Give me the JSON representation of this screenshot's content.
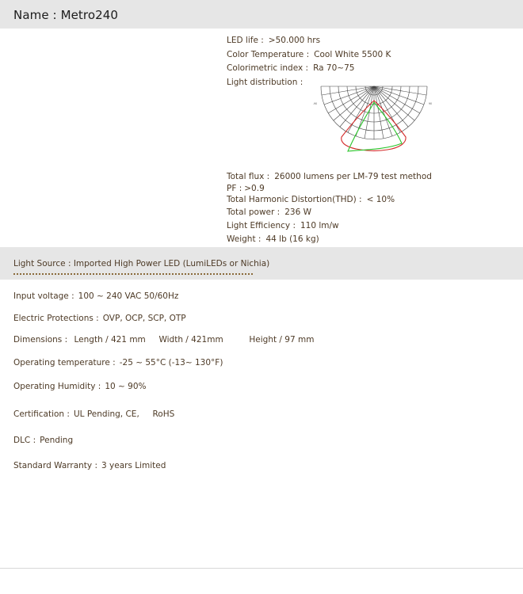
{
  "header": {
    "label": "Name :",
    "value": "Metro240"
  },
  "specs": {
    "led_life": {
      "label": "LED life :",
      "value": ">50.000 hrs"
    },
    "color_temperature": {
      "label": "Color Temperature :",
      "value": "Cool White 5500 K"
    },
    "colorimetric_index": {
      "label": "Colorimetric index :",
      "value": "Ra 70~75"
    },
    "light_distribution": {
      "label": "Light distribution :"
    },
    "total_flux": {
      "label": "Total flux :",
      "value": "26000 lumens per LM-79 test method"
    },
    "pf": {
      "label": "PF :",
      "value": ">0.9"
    },
    "thd": {
      "label": "Total Harmonic Distortion(THD) :",
      "value": "< 10%"
    },
    "total_power": {
      "label": "Total power :",
      "value": "236 W"
    },
    "light_efficiency": {
      "label": "Light Efficiency :",
      "value": "110 lm/w"
    },
    "weight": {
      "label": "Weight :",
      "value": "44 lb (16 kg)"
    }
  },
  "light_source": {
    "text": "Light Source : Imported High Power LED (LumiLEDs or Nichia)"
  },
  "details": {
    "input_voltage": {
      "label": "Input voltage :",
      "value": "100 ~ 240 VAC 50/60Hz"
    },
    "electric_protections": {
      "label": "Electric Protections :",
      "value": "OVP, OCP, SCP, OTP"
    },
    "dimensions": {
      "label": "Dimensions :",
      "length": "Length / 421 mm",
      "width": "Width / 421mm",
      "height": "Height / 97 mm"
    },
    "operating_temperature": {
      "label": "Operating temperature :",
      "value": "-25 ~ 55°C (-13~ 130°F)"
    },
    "operating_humidity": {
      "label": "Operating Humidity :",
      "value": "10 ~ 90%"
    },
    "certification": {
      "label": "Certification :",
      "value1": "UL Pending, CE,",
      "value2": "RoHS"
    },
    "dlc": {
      "label": "DLC :",
      "value": "Pending"
    },
    "warranty": {
      "label": "Standard Warranty :",
      "value": "3 years Limited"
    }
  },
  "polar_diagram": {
    "colors": {
      "grid": "#444444",
      "curve_red": "#d42a2a",
      "curve_green": "#2cc52c"
    },
    "left_angle_label": "-90",
    "right_angle_label": "90"
  }
}
